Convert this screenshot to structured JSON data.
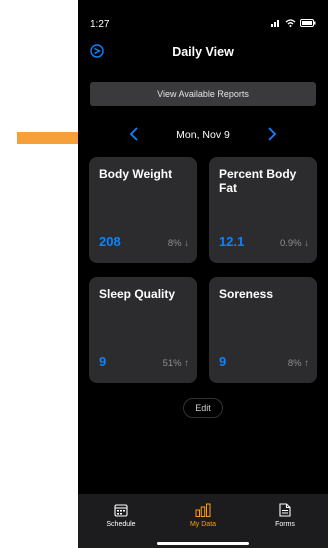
{
  "status_bar": {
    "time": "1:27"
  },
  "header": {
    "title": "Daily View"
  },
  "reports_button": {
    "label": "View Available Reports"
  },
  "date_nav": {
    "date": "Mon, Nov 9"
  },
  "cards": [
    {
      "label": "Body Weight",
      "value": "208",
      "change": "8% ↓"
    },
    {
      "label": "Percent Body Fat",
      "value": "12.1",
      "change": "0.9% ↓"
    },
    {
      "label": "Sleep Quality",
      "value": "9",
      "change": "51% ↑"
    },
    {
      "label": "Soreness",
      "value": "9",
      "change": "8% ↑"
    }
  ],
  "edit_button": {
    "label": "Edit"
  },
  "tabbar": {
    "items": [
      {
        "label": "Schedule",
        "icon": "calendar-icon",
        "active": false
      },
      {
        "label": "My Data",
        "icon": "bar-chart-icon",
        "active": true
      },
      {
        "label": "Forms",
        "icon": "document-icon",
        "active": false
      }
    ]
  },
  "colors": {
    "accent": "#0a84ff",
    "tab_active": "#ff9f0a",
    "annotation_arrow": "#f5a03a",
    "card_bg": "#2c2c2e"
  }
}
